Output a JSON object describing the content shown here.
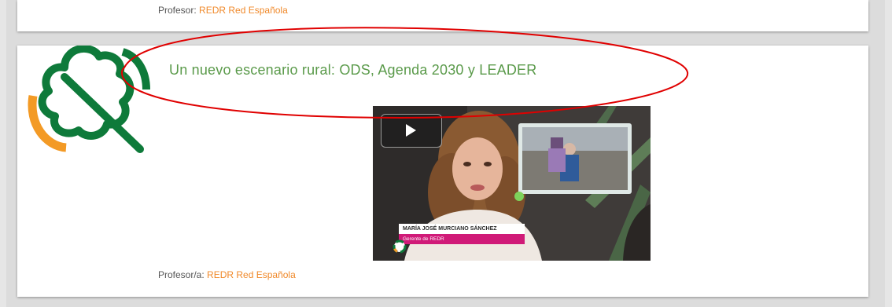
{
  "top_card": {
    "professor_label": "Profesor:",
    "professor_link": "REDR Red Española"
  },
  "course": {
    "title": "Un nuevo escenario rural: ODS, Agenda 2030 y LEADER",
    "professor_label": "Profesor/a:",
    "professor_link": "REDR Red Española",
    "video": {
      "person_name": "MARÍA JOSÉ MURCIANO SÁNCHEZ",
      "person_role": "Gerente de REDR"
    }
  },
  "colors": {
    "link": "#f0892a",
    "title": "#5a9a4a",
    "logo_green": "#0e7a3a",
    "logo_orange": "#f39a25",
    "annotation": "#e00000",
    "role_bar": "#d01a78"
  },
  "icons": {
    "logo": "leaf-logo",
    "play": "play-icon"
  }
}
